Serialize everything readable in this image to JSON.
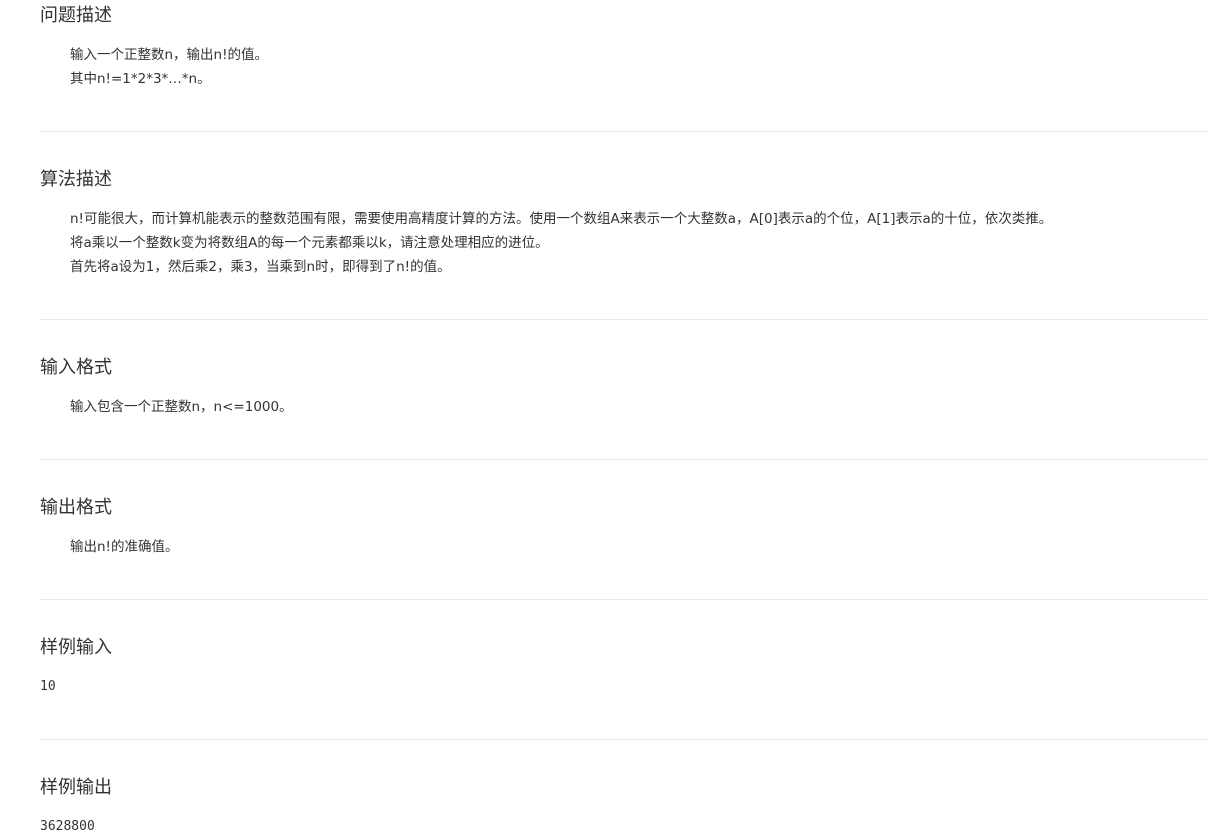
{
  "sections": {
    "problem": {
      "title": "问题描述",
      "lines": [
        "输入一个正整数n，输出n!的值。",
        "其中n!=1*2*3*…*n。"
      ]
    },
    "algorithm": {
      "title": "算法描述",
      "lines": [
        "n!可能很大，而计算机能表示的整数范围有限，需要使用高精度计算的方法。使用一个数组A来表示一个大整数a，A[0]表示a的个位，A[1]表示a的十位，依次类推。",
        "将a乘以一个整数k变为将数组A的每一个元素都乘以k，请注意处理相应的进位。",
        "首先将a设为1，然后乘2，乘3，当乘到n时，即得到了n!的值。"
      ]
    },
    "input_format": {
      "title": "输入格式",
      "lines": [
        "输入包含一个正整数n，n<=1000。"
      ]
    },
    "output_format": {
      "title": "输出格式",
      "lines": [
        "输出n!的准确值。"
      ]
    },
    "sample_input": {
      "title": "样例输入",
      "value": "10"
    },
    "sample_output": {
      "title": "样例输出",
      "value": "3628800"
    }
  }
}
